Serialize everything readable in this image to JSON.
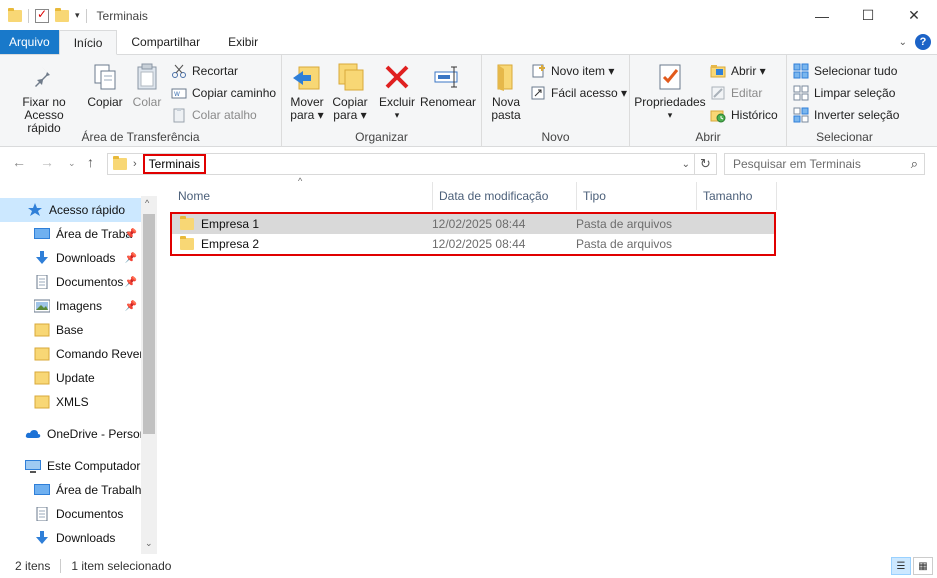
{
  "window": {
    "title": "Terminais",
    "controls": {
      "minimize": "—",
      "maximize": "☐",
      "close": "✕"
    }
  },
  "ribbon_tabs": [
    "Arquivo",
    "Início",
    "Compartilhar",
    "Exibir"
  ],
  "ribbon": {
    "clipboard": {
      "label": "Área de Transferência",
      "pin_line1": "Fixar no",
      "pin_line2": "Acesso rápido",
      "copy": "Copiar",
      "paste": "Colar",
      "cut": "Recortar",
      "copy_path": "Copiar caminho",
      "paste_shortcut": "Colar atalho"
    },
    "organize": {
      "label": "Organizar",
      "move_line1": "Mover",
      "move_line2": "para",
      "copy_line1": "Copiar",
      "copy_line2": "para",
      "delete": "Excluir",
      "rename": "Renomear"
    },
    "new": {
      "label": "Novo",
      "new_folder_line1": "Nova",
      "new_folder_line2": "pasta",
      "new_item": "Novo item",
      "easy_access": "Fácil acesso"
    },
    "open": {
      "label": "Abrir",
      "properties": "Propriedades",
      "open": "Abrir",
      "edit": "Editar",
      "history": "Histórico"
    },
    "select": {
      "label": "Selecionar",
      "select_all": "Selecionar tudo",
      "select_none": "Limpar seleção",
      "invert": "Inverter seleção"
    }
  },
  "address": {
    "crumb": "Terminais",
    "search_placeholder": "Pesquisar em Terminais"
  },
  "nav_pane": {
    "quick_access": "Acesso rápido",
    "items": [
      {
        "label": "Área de Traba",
        "icon": "desktop-icon",
        "pinned": true
      },
      {
        "label": "Downloads",
        "icon": "download-icon",
        "pinned": true
      },
      {
        "label": "Documentos",
        "icon": "document-icon",
        "pinned": true
      },
      {
        "label": "Imagens",
        "icon": "pictures-icon",
        "pinned": true
      },
      {
        "label": "Base",
        "icon": "folder-icon",
        "pinned": false
      },
      {
        "label": "Comando Rever",
        "icon": "folder-icon",
        "pinned": false
      },
      {
        "label": "Update",
        "icon": "folder-icon",
        "pinned": false
      },
      {
        "label": "XMLS",
        "icon": "folder-icon",
        "pinned": false
      }
    ],
    "onedrive": "OneDrive - Persor",
    "this_pc": "Este Computador",
    "pc_items": [
      {
        "label": "Área de Trabalho",
        "icon": "desktop-icon"
      },
      {
        "label": "Documentos",
        "icon": "document-icon"
      },
      {
        "label": "Downloads",
        "icon": "download-icon"
      }
    ]
  },
  "columns": {
    "name": "Nome",
    "date": "Data de modificação",
    "type": "Tipo",
    "size": "Tamanho"
  },
  "files": [
    {
      "name": "Empresa 1",
      "date": "12/02/2025 08:44",
      "type": "Pasta de arquivos",
      "size": "",
      "selected": true
    },
    {
      "name": "Empresa 2",
      "date": "12/02/2025 08:44",
      "type": "Pasta de arquivos",
      "size": "",
      "selected": false
    }
  ],
  "status": {
    "count": "2 itens",
    "selection": "1 item selecionado"
  },
  "colors": {
    "accent": "#1979ca",
    "highlight_red": "#e00000",
    "selection": "#cce8ff",
    "folder": "#f8d775"
  }
}
